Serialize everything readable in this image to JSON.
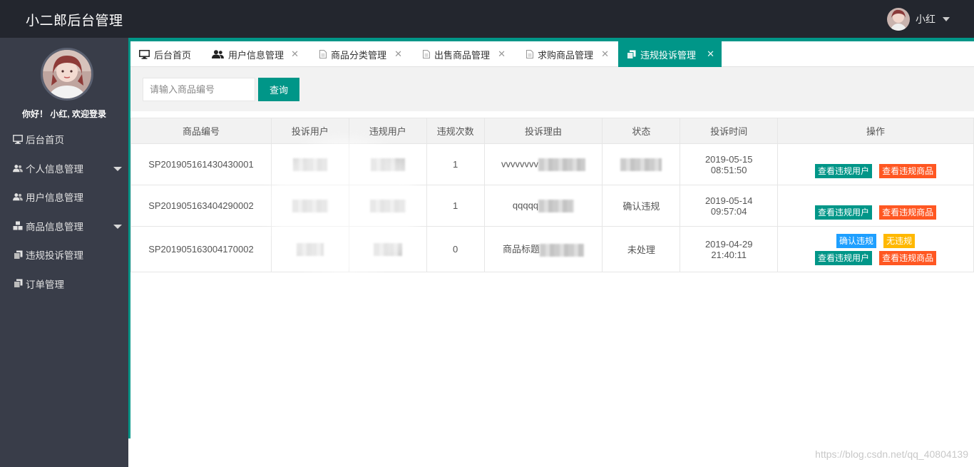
{
  "app": {
    "title": "小二郎后台管理",
    "user_name": "小红"
  },
  "sidebar": {
    "welcome": "你好！ 小红, 欢迎登录",
    "items": [
      {
        "label": "后台首页",
        "icon": "monitor-icon",
        "has_arrow": false
      },
      {
        "label": "个人信息管理",
        "icon": "users-icon",
        "has_arrow": true
      },
      {
        "label": "用户信息管理",
        "icon": "users-icon",
        "has_arrow": false
      },
      {
        "label": "商品信息管理",
        "icon": "cubes-icon",
        "has_arrow": true
      },
      {
        "label": "违规投诉管理",
        "icon": "copy-icon",
        "has_arrow": false
      },
      {
        "label": "订单管理",
        "icon": "copy-icon",
        "has_arrow": false
      }
    ]
  },
  "tabs": [
    {
      "label": "后台首页",
      "icon": "monitor-icon",
      "closable": false,
      "active": false
    },
    {
      "label": "用户信息管理",
      "icon": "users-icon",
      "closable": true,
      "active": false
    },
    {
      "label": "商品分类管理",
      "icon": "file-icon",
      "closable": true,
      "active": false
    },
    {
      "label": "出售商品管理",
      "icon": "file-icon",
      "closable": true,
      "active": false
    },
    {
      "label": "求购商品管理",
      "icon": "file-icon",
      "closable": true,
      "active": false
    },
    {
      "label": "违规投诉管理",
      "icon": "copy-icon",
      "closable": true,
      "active": true
    }
  ],
  "search": {
    "placeholder": "请输入商品编号",
    "value": "",
    "button_label": "查询"
  },
  "table": {
    "headers": [
      "商品编号",
      "投诉用户",
      "违规用户",
      "违规次数",
      "投诉理由",
      "状态",
      "投诉时间",
      "操作"
    ],
    "rows": [
      {
        "product_no": "SP201905161430430001",
        "complainant": "",
        "violator": "",
        "count": "1",
        "reason": "vvvvvvvv",
        "status": "",
        "date": "2019-05-15",
        "time": "08:51:50",
        "actions": [
          "查看违规用户",
          "查看违规商品"
        ]
      },
      {
        "product_no": "SP201905163404290002",
        "complainant": "",
        "violator": "",
        "count": "1",
        "reason": "qqqqq",
        "status": "确认违规",
        "date": "2019-05-14",
        "time": "09:57:04",
        "actions": [
          "查看违规用户",
          "查看违规商品"
        ]
      },
      {
        "product_no": "SP201905163004170002",
        "complainant": "",
        "violator": "",
        "count": "0",
        "reason": "商品标题",
        "status": "未处理",
        "date": "2019-04-29",
        "time": "21:40:11",
        "extra_actions": [
          "确认违规",
          "无违规"
        ],
        "actions": [
          "查看违规用户",
          "查看违规商品"
        ]
      }
    ]
  },
  "watermark": "https://blog.csdn.net/qq_40804139",
  "colors": {
    "header_bg": "#23262e",
    "sidebar_bg": "#393d49",
    "accent": "#009688",
    "danger": "#ff5722",
    "info": "#1e9fff",
    "warn": "#ffb800"
  }
}
